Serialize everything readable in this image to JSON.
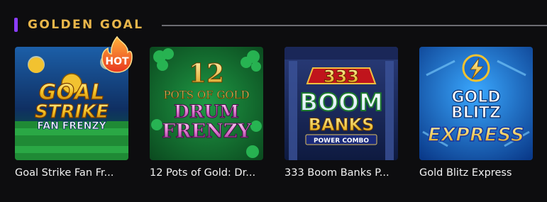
{
  "section": {
    "title": "GOLDEN GOAL",
    "accent_color": "#8b3dff",
    "title_color": "#e9b64a"
  },
  "games": [
    {
      "label": "Goal Strike Fan Fr...",
      "art": {
        "line1": "GOAL",
        "line2": "STRIKE",
        "line3": "FAN FRENZY"
      },
      "badge": "HOT"
    },
    {
      "label": "12 Pots of Gold: Dr...",
      "art": {
        "line1": "12",
        "line2": "POTS OF GOLD",
        "line3": "DRUM",
        "line4": "FRENZY"
      }
    },
    {
      "label": "333 Boom Banks P...",
      "art": {
        "line1": "333",
        "line2": "BOOM",
        "line3": "BANKS",
        "line4": "POWER COMBO"
      }
    },
    {
      "label": "Gold Blitz Express",
      "art": {
        "line1": "GOLD",
        "line2": "BLITZ",
        "line3": "EXPRESS"
      }
    }
  ]
}
